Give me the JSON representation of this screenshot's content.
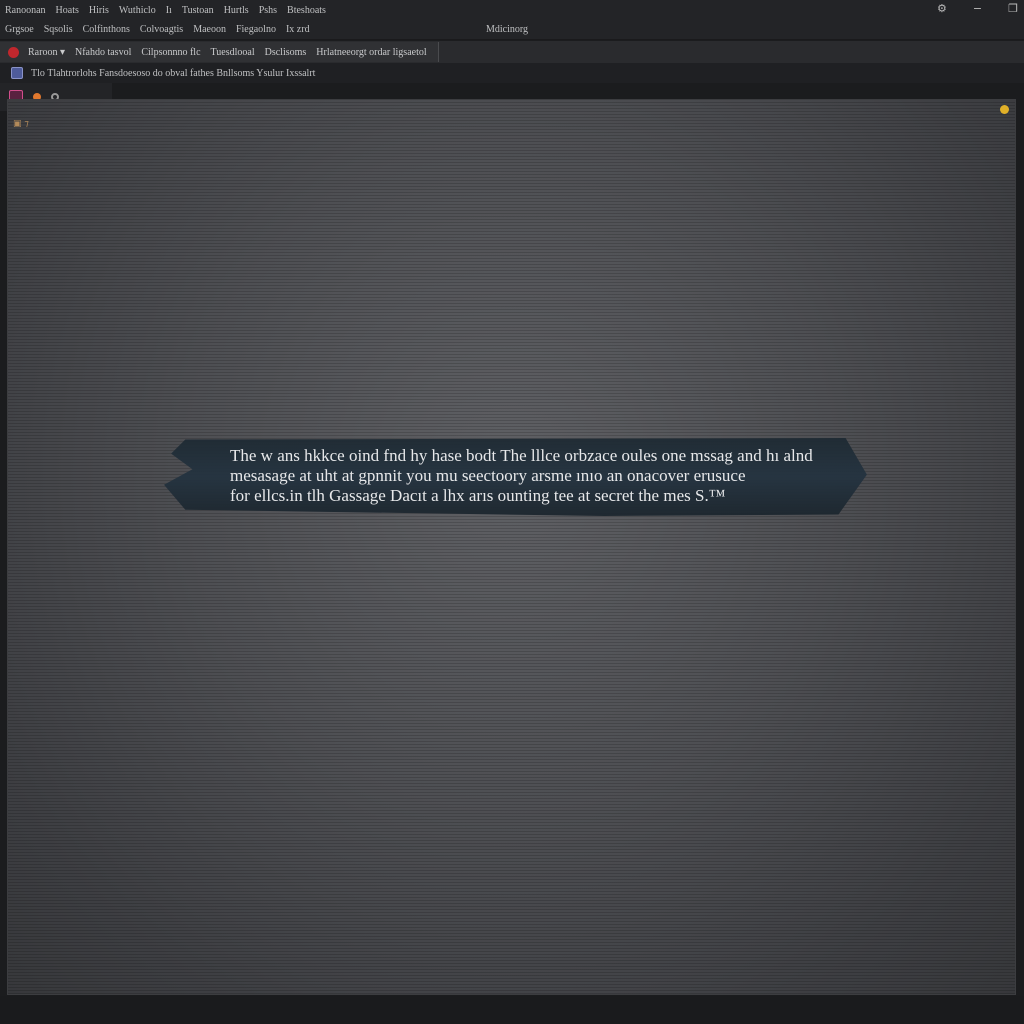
{
  "menubar": {
    "items": [
      "Ranoonan",
      "Hoats",
      "Hiris",
      "Wuthiclo",
      "Iı",
      "Tustoan",
      "Hurtls",
      "Pshs",
      "Bteshoats"
    ]
  },
  "window_controls": {
    "settings": "⚙",
    "minimize": "−",
    "maximize": "❐"
  },
  "menubar2": {
    "items": [
      "Grgsoe",
      "Sqsolis",
      "Colfinthons",
      "Colvoagtis",
      "Maeoon",
      "Fiegaolno",
      "Ix zrd"
    ],
    "right": "Mdicinorg"
  },
  "tabbar": {
    "tabs": [
      "Raroon ▾",
      "Nfahdo tasvol",
      "Cilpsonnno flc",
      "Tuesdlooal",
      "Dsclisoms",
      "Hrlatneeorgt ordar ligsaetol"
    ]
  },
  "address": {
    "text": "Tlo Tlahtrorlohs   Fansdoesoso do obval fathes Bnllsoms Ysulur Ixssalrt"
  },
  "message": {
    "lines": [
      "The w ans hkkce oind fnd hy hase bodt The lllce orbzace oules one mssag and hı alnd",
      "mesasage at uht at gpnnit you mu seectoory arsme ınıo an onacover erusuce",
      "for ellcs.in tlh Gassage Dacıt a lhx arıs ounting tee at secret the mes S.™"
    ]
  },
  "colors": {
    "accent_red": "#c0272d",
    "accent_orange": "#e1782e",
    "accent_yellow": "#e0b028",
    "banner_bg": "#243340",
    "content_bg": "#55565a"
  }
}
